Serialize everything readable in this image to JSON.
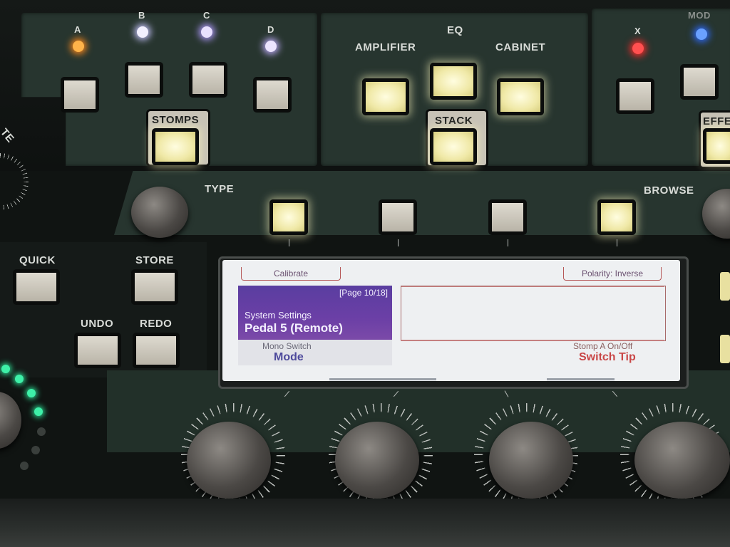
{
  "top_panel": {
    "stomp_leds": [
      "A",
      "B",
      "C",
      "D"
    ],
    "eq_label": "EQ",
    "amplifier_label": "AMPLIFIER",
    "cabinet_label": "CABINET",
    "stack_label": "STACK",
    "stomps_label": "STOMPS",
    "x_label": "X",
    "mod_label": "MOD",
    "effects_label_partial": "EFFE",
    "rate_label_partial": "TE",
    "led_colors": {
      "A": "#ff8a1c",
      "B": "#c9c6ff",
      "C": "#b29bff",
      "D": "#c4b0ff",
      "X": "#ff2a2a",
      "MOD": "#2e6bff"
    }
  },
  "mid_panel": {
    "type_label": "TYPE",
    "browse_label": "BROWSE",
    "quick_label": "QUICK",
    "store_label": "STORE",
    "undo_label": "UNDO",
    "redo_label": "REDO"
  },
  "lcd": {
    "calibrate_tab": "Calibrate",
    "polarity_tab": "Polarity: Inverse",
    "page_indicator": "[Page 10/18]",
    "section_title": "System Settings",
    "selected_item": "Pedal 5 (Remote)",
    "param1_label": "Mono Switch",
    "param1_value": "Mode",
    "param2_label": "Stomp A On/Off",
    "param2_value": "Switch Tip"
  },
  "colors": {
    "panel_green": "#27352f",
    "lcd_purple": "#6b3fa6",
    "lcd_value_red": "#c94747",
    "lcd_value_blue": "#4e4a9c",
    "lit_button": "#f0e9a8"
  }
}
